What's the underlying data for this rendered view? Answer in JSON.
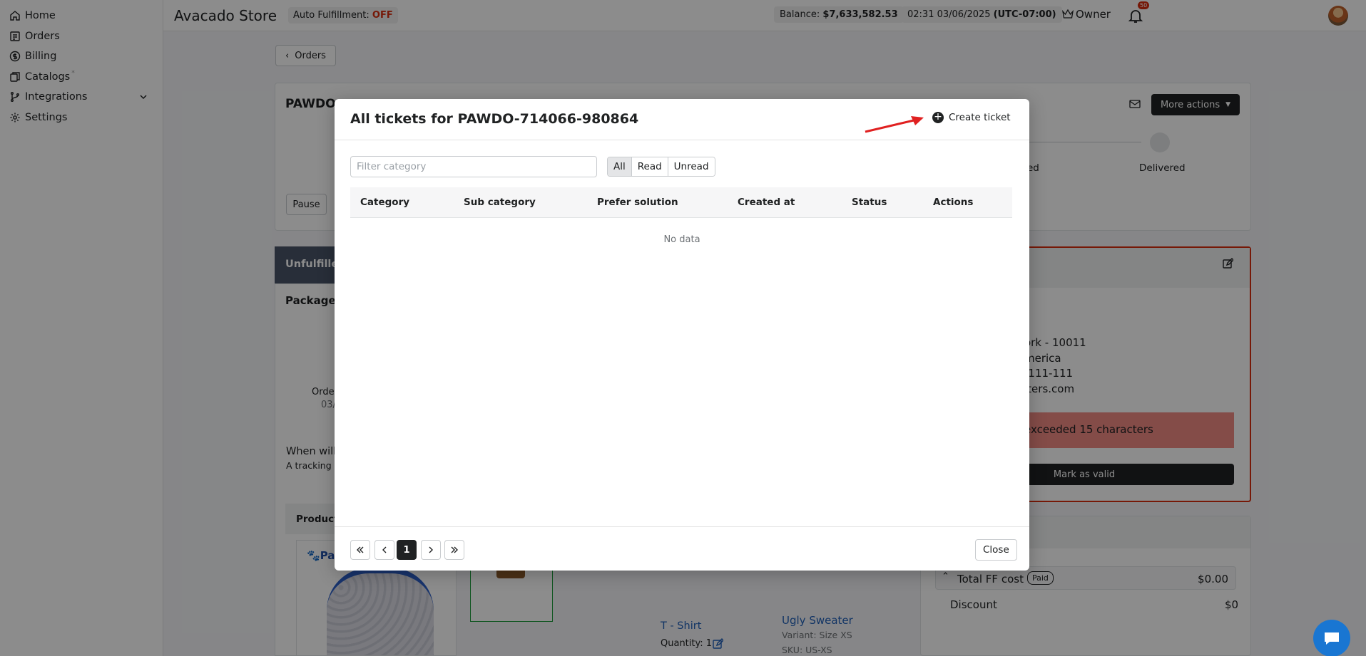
{
  "sidebar": {
    "items": [
      {
        "label": "Home",
        "icon": "home-icon"
      },
      {
        "label": "Orders",
        "icon": "orders-icon"
      },
      {
        "label": "Billing",
        "icon": "dollar-icon"
      },
      {
        "label": "Catalogs",
        "icon": "catalog-icon",
        "sup": "*"
      },
      {
        "label": "Integrations",
        "icon": "branch-icon"
      },
      {
        "label": "Settings",
        "icon": "gear-icon"
      }
    ]
  },
  "topbar": {
    "store_name": "Avacado Store",
    "auto_fulfillment_label": "Auto Fulfillment:",
    "auto_fulfillment_value": "OFF",
    "balance_label": "Balance:",
    "balance_value": "$7,633,582.53",
    "time": "02:31 03/06/2025",
    "timezone": "(UTC-07:00)",
    "role": "Owner",
    "notifications": "50"
  },
  "background": {
    "back_label": "Orders",
    "order_prefix": "PAWDO-",
    "more_actions": "More actions",
    "delivered": "Delivered",
    "ed_partial": "ed",
    "pause": "Pause",
    "unfulfilled": "Unfulfilled",
    "package": "Package",
    "order_partial": "Orde",
    "date_partial": "03/",
    "when_will": "When will",
    "a_tracking": "A tracking",
    "product": "Product",
    "address_line1": "ork - 10011",
    "address_line2": "merica",
    "address_line3": "-111-111",
    "address_line4": "iters.com",
    "error_text": "exceeded 15 characters",
    "mark_valid": "Mark as valid",
    "t_shirt": "T - Shirt",
    "quantity": "Quantity: 1",
    "ugly_sweater": "Ugly Sweater",
    "variant": "Variant: Size XS",
    "sku": "SKU: US-XS",
    "total_ff_cost": "Total FF cost",
    "paid": "Paid",
    "total_ff_value": "$0.00",
    "discount": "Discount",
    "discount_value": "$0",
    "brand_partial": "Pa"
  },
  "modal": {
    "title": "All tickets for PAWDO-714066-980864",
    "create_ticket": "Create ticket",
    "filter_placeholder": "Filter category",
    "filters": [
      "All",
      "Read",
      "Unread"
    ],
    "active_filter": "All",
    "columns": [
      "Category",
      "Sub category",
      "Prefer solution",
      "Created at",
      "Status",
      "Actions"
    ],
    "empty_text": "No data",
    "pagination": {
      "current_page": "1"
    },
    "close_label": "Close"
  },
  "colors": {
    "accent_dark": "#202223",
    "off_red": "#d72c0d",
    "arrow_red": "#e02020",
    "error_bg": "#f08a84"
  }
}
